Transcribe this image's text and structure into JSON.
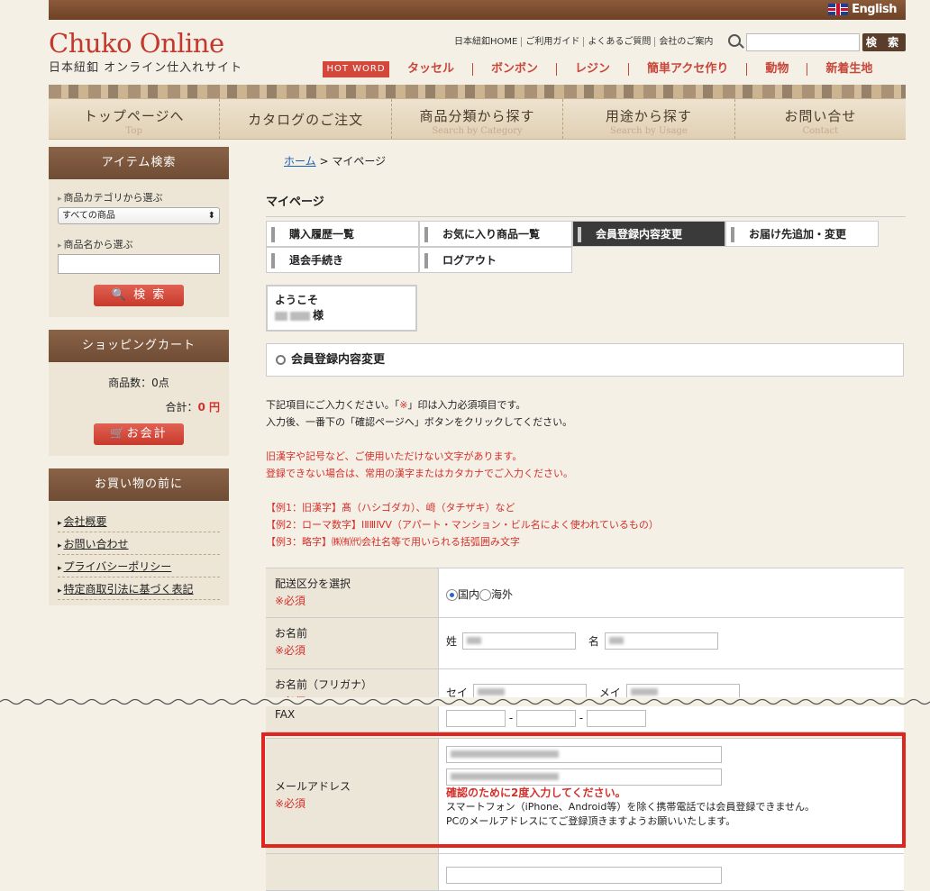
{
  "header": {
    "lang": "English",
    "logo_main": "Chuko Online",
    "logo_sub": "日本紐釦  オンライン仕入れサイト",
    "utils": [
      "日本紐釦HOME",
      "ご利用ガイド",
      "よくあるご質問",
      "会社のご案内"
    ],
    "search_button": "検 索",
    "hotword_label": "HOT WORD",
    "hotwords": [
      "タッセル",
      "ボンボン",
      "レジン",
      "簡単アクセ作り",
      "動物",
      "新着生地"
    ]
  },
  "nav": [
    {
      "main": "トップページへ",
      "sub": "Top"
    },
    {
      "main": "カタログのご注文",
      "sub": ""
    },
    {
      "main": "商品分類から探す",
      "sub": "Search by Category"
    },
    {
      "main": "用途から探す",
      "sub": "Search by Usage"
    },
    {
      "main": "お問い合せ",
      "sub": "Contact"
    }
  ],
  "sidebar": {
    "item_search_title": "アイテム検索",
    "category_label": "商品カテゴリから選ぶ",
    "category_selected": "すべての商品",
    "name_label": "商品名から選ぶ",
    "search_button": "検 索",
    "cart_title": "ショッピングカート",
    "cart_count": "商品数：0点",
    "cart_total_label": "合計：",
    "cart_total_value": "0 円",
    "checkout_button": "お会計",
    "before_title": "お買い物の前に",
    "before_links": [
      "会社概要",
      "お問い合わせ",
      "プライバシーポリシー",
      "特定商取引法に基づく表記"
    ]
  },
  "main": {
    "breadcrumb_home": "ホーム",
    "breadcrumb_current": "> マイページ",
    "page_title": "マイページ",
    "tabs": [
      "購入履歴一覧",
      "お気に入り商品一覧",
      "会員登録内容変更",
      "お届け先追加・変更",
      "退会手続き",
      "ログアウト"
    ],
    "welcome": "ようこそ",
    "welcome_suffix": "様",
    "section_title": "会員登録内容変更",
    "intro1a": "下記項目にご入力ください。「",
    "intro1b": "※",
    "intro1c": "」印は入力必須項目です。",
    "intro2": "入力後、一番下の「確認ページへ」ボタンをクリックしてください。",
    "warn1": "旧漢字や記号など、ご使用いただけない文字があります。",
    "warn2": "登録できない場合は、常用の漢字またはカタカナでご入力ください。",
    "ex1": "【例1：旧漢字】髙（ハシゴダカ）、﨑（タチザキ）など",
    "ex2": "【例2：ローマ数字】ⅠⅡⅢⅣⅤ（アパート・マンション・ビル名によく使われているもの）",
    "ex3": "【例3：略字】㈱㈲㈹会社名等で用いられる括弧囲み文字"
  },
  "form": {
    "required": "※必須",
    "delivery_label": "配送区分を選択",
    "domestic": "国内",
    "overseas": "海外",
    "name_label": "お名前",
    "sei": "姓",
    "mei": "名",
    "kana_label": "お名前（フリガナ）",
    "kana_sei": "セイ",
    "kana_mei": "メイ",
    "fax_label": "FAX",
    "email_label": "メールアドレス",
    "email_note_red": "確認のために2度入力してください。",
    "email_note1": "スマートフォン（iPhone、Android等）を除く携帯電話では会員登録できません。",
    "email_note2": "PCのメールアドレスにてご登録頂きますようお願いいたします。"
  }
}
